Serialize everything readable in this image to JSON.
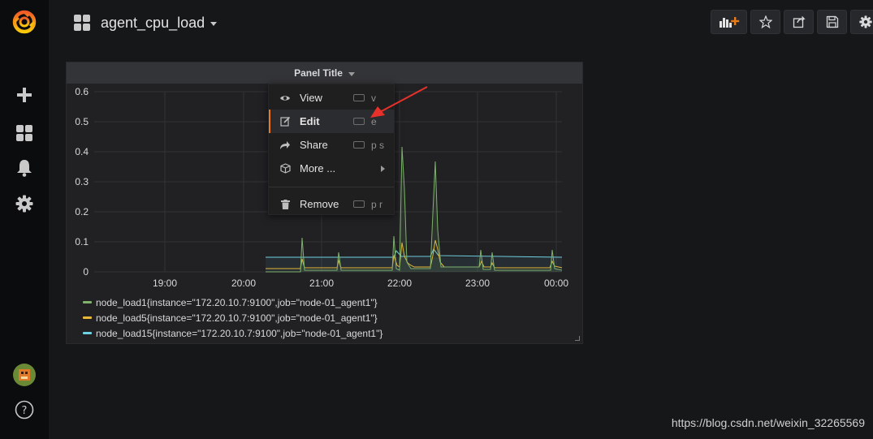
{
  "dashboard": {
    "title": "agent_cpu_load"
  },
  "panel": {
    "title": "Panel Title",
    "y_ticks": [
      "0.6",
      "0.5",
      "0.4",
      "0.3",
      "0.2",
      "0.1",
      "0"
    ],
    "x_ticks": [
      "19:00",
      "20:00",
      "21:00",
      "22:00",
      "23:00",
      "00:00"
    ]
  },
  "legend": [
    {
      "label": "node_load1{instance=\"172.20.10.7:9100\",job=\"node-01_agent1\"}",
      "color": "#7eb26d"
    },
    {
      "label": "node_load5{instance=\"172.20.10.7:9100\",job=\"node-01_agent1\"}",
      "color": "#eab839"
    },
    {
      "label": "node_load15{instance=\"172.20.10.7:9100\",job=\"node-01_agent1\"}",
      "color": "#6ed0e0"
    }
  ],
  "menu": {
    "items": [
      {
        "label": "View",
        "shortcut": "v",
        "icon": "eye-icon"
      },
      {
        "label": "Edit",
        "shortcut": "e",
        "icon": "edit-icon"
      },
      {
        "label": "Share",
        "shortcut": "p s",
        "icon": "share-icon"
      },
      {
        "label": "More ...",
        "shortcut": "",
        "icon": "cube-icon"
      },
      {
        "label": "Remove",
        "shortcut": "p r",
        "icon": "trash-icon"
      }
    ]
  },
  "watermark": "https://blog.csdn.net/weixin_32265569",
  "colors": {
    "accent": "#eb7b18",
    "annotation_arrow": "#e8312a",
    "grafana_orange": "#f05a28"
  }
}
